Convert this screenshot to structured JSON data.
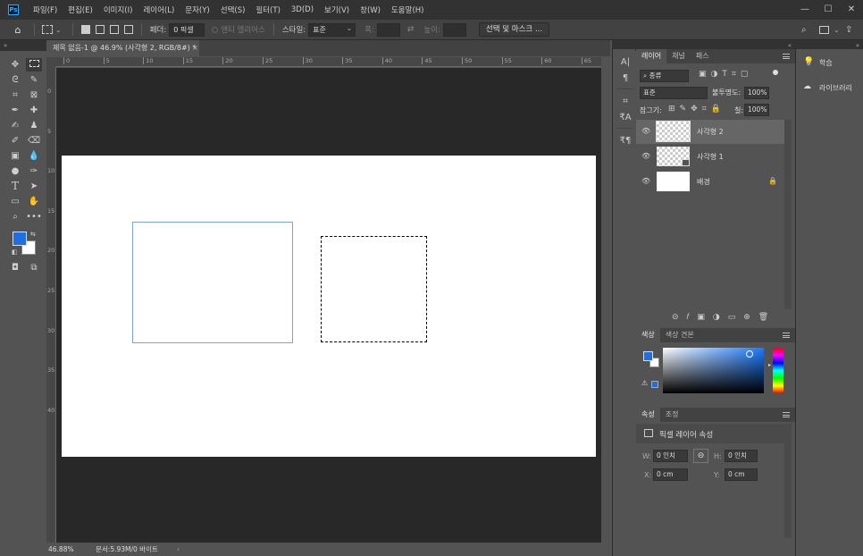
{
  "app": {
    "logo": "Ps"
  },
  "menu": [
    "파일(F)",
    "편집(E)",
    "이미지(I)",
    "레이어(L)",
    "문자(Y)",
    "선택(S)",
    "필터(T)",
    "3D(D)",
    "보기(V)",
    "창(W)",
    "도움말(H)"
  ],
  "window_controls": {
    "minimize": "—",
    "maximize": "☐",
    "close": "✕"
  },
  "options": {
    "feather_label": "페더:",
    "feather_value": "0 픽셀",
    "antialias_label": "앤티 앨리어스",
    "style_label": "스타일:",
    "style_value": "표준",
    "width_label": "폭:",
    "height_label": "높이:",
    "select_mask_button": "선택 및 마스크 ..."
  },
  "strip": {
    "left": "«",
    "right": "»"
  },
  "document": {
    "tab_title": "제목 없음-1 @ 46.9% (사각형 2, RGB/8#) *",
    "zoom": "46.88%",
    "doc_info": "문서:5.93M/0 바이트",
    "doc_info_arrow": "›"
  },
  "ruler": {
    "top": [
      "0",
      "5",
      "10",
      "15",
      "20",
      "25",
      "30",
      "35",
      "40",
      "45",
      "50",
      "55",
      "60",
      "65"
    ],
    "left": [
      "0",
      "5",
      "10",
      "15",
      "20",
      "25",
      "30",
      "35",
      "40"
    ]
  },
  "colors": {
    "foreground": "#1f6fe0",
    "background": "#ffffff",
    "panel_dark": "#323232",
    "panel_mid": "#424242",
    "panel_light": "#535353"
  },
  "layers_panel": {
    "tabs": [
      "레이어",
      "채널",
      "패스"
    ],
    "filter_kind": "종류",
    "blend_mode": "표준",
    "opacity_label": "불투명도:",
    "opacity_value": "100%",
    "lock_label": "잠그기:",
    "fill_label": "칠:",
    "fill_value": "100%",
    "layers": [
      {
        "name": "사각형 2",
        "selected": true
      },
      {
        "name": "사각형 1",
        "selected": false
      },
      {
        "name": "배경",
        "selected": false,
        "locked": true
      }
    ]
  },
  "color_panel": {
    "tabs": [
      "색상",
      "색상 견본"
    ]
  },
  "properties_panel": {
    "tabs": [
      "속성",
      "조정"
    ],
    "title": "픽셀 레이어 속성",
    "w_label": "W:",
    "w_value": "0 인치",
    "h_label": "H:",
    "h_value": "0 인치",
    "x_label": "X:",
    "x_value": "0 cm",
    "y_label": "Y:",
    "y_value": "0 cm"
  },
  "learn_panel": {
    "learn": "학습",
    "libraries": "라이브러리"
  }
}
